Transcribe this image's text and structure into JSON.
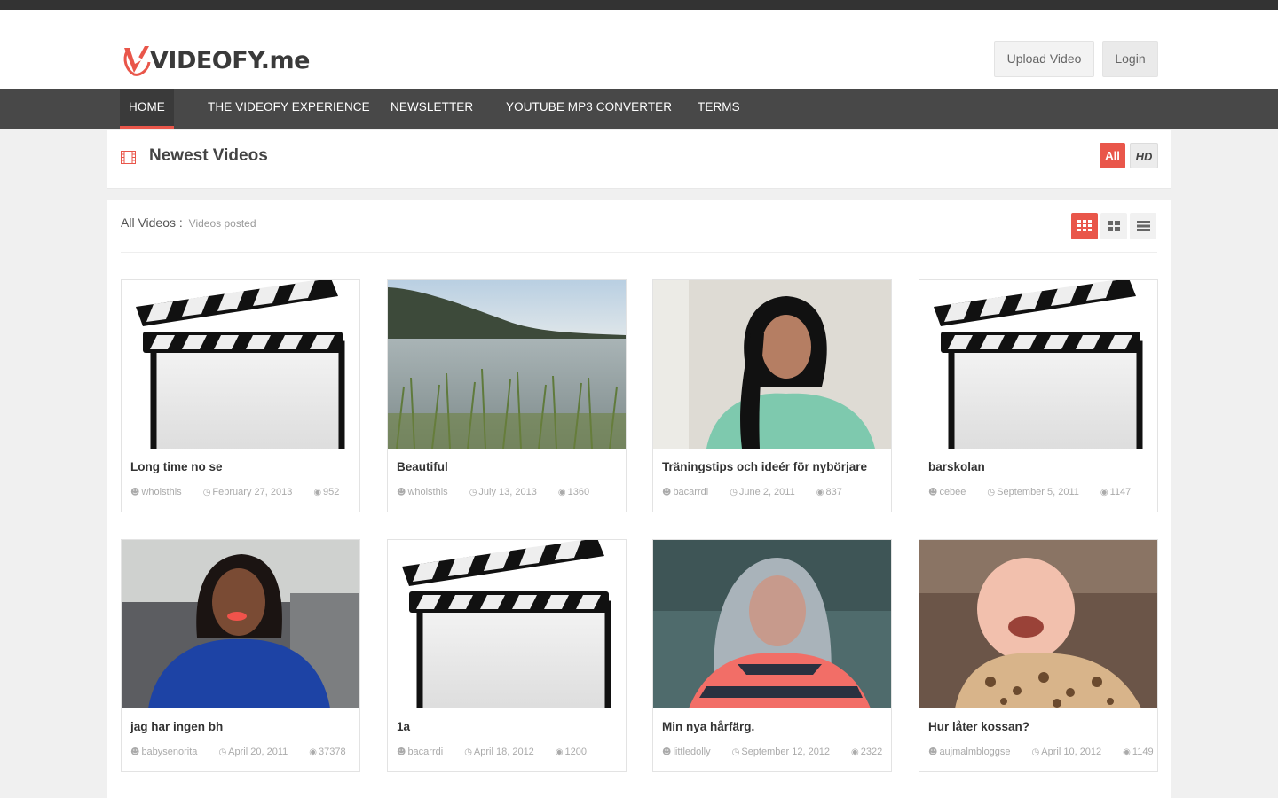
{
  "header": {
    "logo_text": "VIDEOFY.me",
    "upload_label": "Upload Video",
    "login_label": "Login"
  },
  "nav": {
    "items": [
      "HOME",
      "THE VIDEOFY EXPERIENCE",
      "NEWSLETTER",
      "YOUTUBE MP3 CONVERTER",
      "TERMS"
    ],
    "active": "HOME"
  },
  "section": {
    "title": "Newest Videos",
    "filter_all": "All",
    "filter_hd": "HD"
  },
  "listing": {
    "label": "All Videos :",
    "sub_label": "Videos posted"
  },
  "videos": [
    {
      "title": "Long time no se",
      "user": "whoisthis",
      "date": "February 27, 2013",
      "views": "952",
      "thumb": "clapper"
    },
    {
      "title": "Beautiful",
      "user": "whoisthis",
      "date": "July 13, 2013",
      "views": "1360",
      "thumb": "lake"
    },
    {
      "title": "Träningstips och ideér för nybörjare",
      "user": "bacarrdi",
      "date": "June 2, 2011",
      "views": "837",
      "thumb": "person-teal"
    },
    {
      "title": "barskolan",
      "user": "cebee",
      "date": "September 5, 2011",
      "views": "1147",
      "thumb": "clapper"
    },
    {
      "title": "jag har ingen bh",
      "user": "babysenorita",
      "date": "April 20, 2011",
      "views": "37378",
      "thumb": "person-blue"
    },
    {
      "title": "1a",
      "user": "bacarrdi",
      "date": "April 18, 2012",
      "views": "1200",
      "thumb": "clapper"
    },
    {
      "title": "Min nya hårfärg.",
      "user": "littledolly",
      "date": "September 12, 2012",
      "views": "2322",
      "thumb": "person-pink"
    },
    {
      "title": "Hur låter kossan?",
      "user": "aujmalmbloggse",
      "date": "April 10, 2012",
      "views": "1149",
      "thumb": "baby"
    }
  ],
  "colors": {
    "accent": "#e9564a",
    "nav_bg": "#484848",
    "topstrip": "#333333"
  }
}
